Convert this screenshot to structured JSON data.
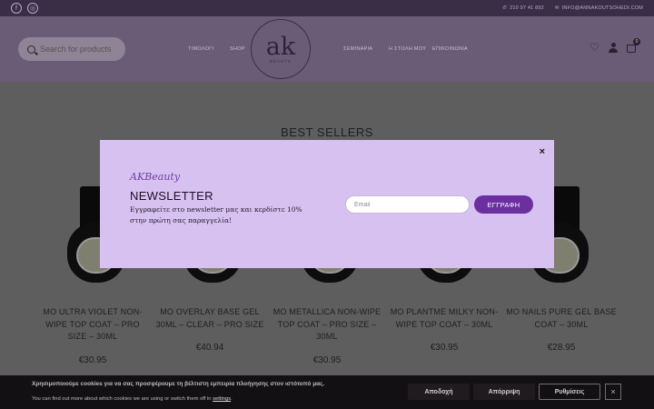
{
  "topbar": {
    "social": [
      {
        "icon": "facebook-icon",
        "glyph": "f"
      },
      {
        "icon": "instagram-icon",
        "glyph": "◎"
      }
    ],
    "phone": "210 97 41 892",
    "email": "INFO@ANNAKOUTSOHEDI.COM"
  },
  "header": {
    "search_placeholder": "Search for products",
    "nav": [
      "ΤΙΜΟΛΟΓΙ",
      "SHOP",
      "ΣΕΜΙΝΑΡΙΑ",
      "Η ΣΤΟΛΗ ΜΟΥ",
      "ΕΠΙΚΟΙΝΩΝΙΑ"
    ],
    "logo_text": "ak",
    "logo_sub": "BEAUTY",
    "cart_count": "0"
  },
  "section": {
    "title": "BEST SELLERS"
  },
  "products": [
    {
      "name": "MO ULTRA VIOLET NON-WIPE TOP COAT – PRO SIZE – 30ML",
      "price": "€30.95"
    },
    {
      "name": "MO OVERLAY BASE GEL 30ML – CLEAR – PRO SIZE",
      "price": "€40.94"
    },
    {
      "name": "MO METALLICA NON-WIPE TOP COAT – PRO SIZE – 30ML",
      "price": "€30.95"
    },
    {
      "name": "MO PLANTME MILKY NON-WIPE TOP COAT – 30ML",
      "price": "€30.95"
    },
    {
      "name": "MO NAILS PURE GEL BASE COAT – 30ML",
      "price": "€28.95"
    }
  ],
  "modal": {
    "brand": "AKBeauty",
    "title": "NEWSLETTER",
    "text": "Εγγραφείτε στο newsletter μας και κερδίστε 10% στην πρώτη σας παραγγελία!",
    "email_placeholder": "Email",
    "button": "ΕΓΓΡΑΦΗ",
    "close": "×"
  },
  "cookie": {
    "main": "Χρησιμοποιούμε cookies για να σας προσφέρουμε τη βέλτιστη εμπειρία πλοήγησης στον ιστότοπό μας.",
    "sub_before": "You can find out more about which cookies we are using or switch them off in ",
    "sub_link": "settings",
    "sub_after": ".",
    "reject": "Απόρριψη",
    "accept": "Αποδοχή",
    "settings": "Ρυθμίσεις",
    "close": "×"
  },
  "colors": {
    "modal_bg": "#d7c1f0",
    "accent": "#6b2fa0",
    "header_bg": "#6a5b76",
    "topbar_bg": "#3a2e46"
  }
}
